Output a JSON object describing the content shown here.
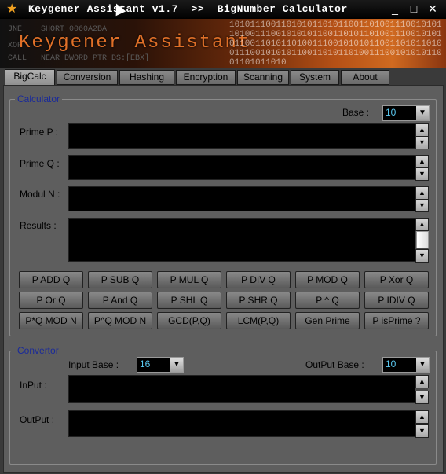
{
  "window": {
    "title": "Keygener Assistant v1.7  >>  BigNumber Calculator",
    "icon": "star-icon",
    "controls": [
      "_",
      "□",
      "✕"
    ]
  },
  "banner": {
    "asm_lines": [
      "JNE    SHORT 0060A2BA",
      "XOR",
      "CALL   NEAR DWORD PTR DS:[EBX]"
    ],
    "title": "Keygener Assistant",
    "bits": "1010111001101010110101100110100111001010110100111001010101100110101101001110010101011001101011010011100101010110011010110100111001010101100110101101001110010101011001101011010"
  },
  "tabs": [
    "BigCalc",
    "Conversion",
    "Hashing",
    "Encryption",
    "Scanning",
    "System",
    "About"
  ],
  "calculator": {
    "legend": "Calculator",
    "base_label": "Base :",
    "base_value": "10",
    "prime_p_label": "Prime P :",
    "prime_q_label": "Prime Q :",
    "modul_n_label": "Modul N :",
    "results_label": "Results :",
    "buttons": [
      [
        "P ADD Q",
        "P SUB Q",
        "P MUL Q",
        "P DIV Q",
        "P MOD Q",
        "P Xor Q"
      ],
      [
        "P Or Q",
        "P And Q",
        "P SHL Q",
        "P SHR Q",
        "P ^ Q",
        "P IDIV Q"
      ],
      [
        "P*Q MOD N",
        "P^Q MOD N",
        "GCD(P,Q)",
        "LCM(P,Q)",
        "Gen Prime",
        "P isPrime ?"
      ]
    ]
  },
  "convertor": {
    "legend": "Convertor",
    "input_base_label": "Input Base :",
    "input_base_value": "16",
    "output_base_label": "OutPut Base :",
    "output_base_value": "10",
    "input_label": "InPut  :",
    "output_label": "OutPut  :"
  },
  "colors": {
    "legend": "#1a2a9a",
    "select_text": "#5ac8f0",
    "panel": "#5e5e5e",
    "accent": "#e07028"
  }
}
